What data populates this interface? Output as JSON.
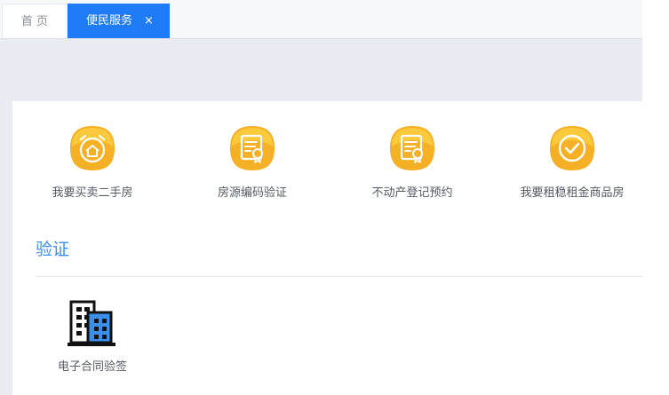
{
  "tabs": [
    {
      "label": "首 页",
      "active": false
    },
    {
      "label": "便民服务",
      "active": true,
      "close_glyph": "×"
    }
  ],
  "services": [
    {
      "label": "我要买卖二手房",
      "icon": "alarm-house-icon"
    },
    {
      "label": "房源编码验证",
      "icon": "certificate-icon"
    },
    {
      "label": "不动产登记预约",
      "icon": "certificate-icon"
    },
    {
      "label": "我要租稳租金商品房",
      "icon": "check-circle-icon"
    }
  ],
  "section": {
    "title": "验证"
  },
  "verify_items": [
    {
      "label": "电子合同验签",
      "icon": "building-icon"
    }
  ],
  "colors": {
    "tab_active_bg": "#1f7cf7",
    "icon_yellow": "#f7b92b",
    "section_title": "#3d8ef2",
    "content_bg": "#e9ecf3"
  }
}
